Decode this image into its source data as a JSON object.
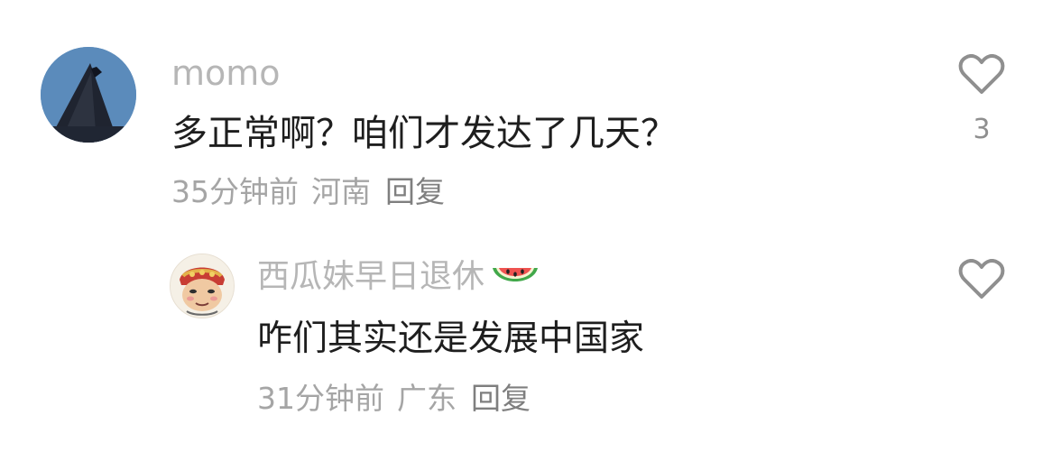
{
  "comments": [
    {
      "username": "momo",
      "content": "多正常啊？咱们才发达了几天？",
      "time": "35分钟前",
      "location": "河南",
      "reply_label": "回复",
      "likes": "3"
    },
    {
      "username": "西瓜妹早日退休",
      "username_icon": "watermelon-icon",
      "content": "咋们其实还是发展中国家",
      "time": "31分钟前",
      "location": "广东",
      "reply_label": "回复"
    }
  ],
  "colors": {
    "background": "#ffffff",
    "username": "#b6b6b6",
    "content": "#1e1e1e",
    "meta": "#a5a5a5",
    "reply": "#7f7f7f",
    "heart": "#8f8f8f"
  }
}
